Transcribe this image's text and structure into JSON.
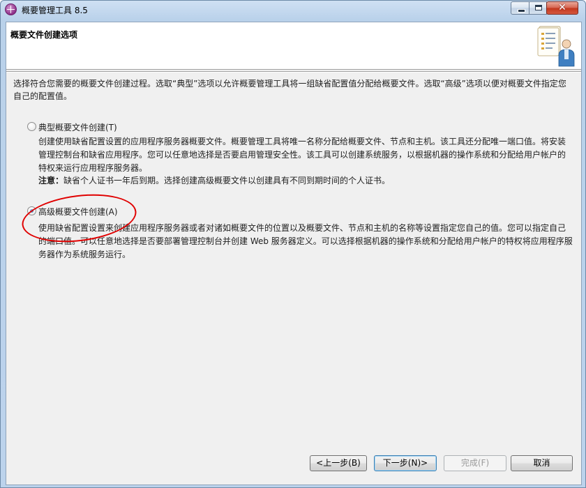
{
  "window": {
    "title": "概要管理工具 8.5",
    "min_glyph": "minimize",
    "max_glyph": "maximize",
    "close_glyph": "✕"
  },
  "banner": {
    "title": "概要文件创建选项",
    "graphic_icon": "document-with-user-icon"
  },
  "intro": "选择符合您需要的概要文件创建过程。选取“典型”选项以允许概要管理工具将一组缺省配置值分配给概要文件。选取“高级”选项以便对概要文件指定您自己的配置值。",
  "options": [
    {
      "label": "典型概要文件创建(T)",
      "selected": false,
      "description": "创建使用缺省配置设置的应用程序服务器概要文件。概要管理工具将唯一名称分配给概要文件、节点和主机。该工具还分配唯一端口值。将安装管理控制台和缺省应用程序。您可以任意地选择是否要启用管理安全性。该工具可以创建系统服务，以根据机器的操作系统和分配给用户帐户的特权来运行应用程序服务器。",
      "note_label": "注意：",
      "note_text": "缺省个人证书一年后到期。选择创建高级概要文件以创建具有不同到期时间的个人证书。"
    },
    {
      "label": "高级概要文件创建(A)",
      "selected": true,
      "description": "使用缺省配置设置来创建应用程序服务器或者对诸如概要文件的位置以及概要文件、节点和主机的名称等设置指定您自己的值。您可以指定自己的端口值。可以任意地选择是否要部署管理控制台并创建 Web 服务器定义。可以选择根据机器的操作系统和分配给用户帐户的特权将应用程序服务器作为系统服务运行。"
    }
  ],
  "annotation": {
    "color": "#e00000",
    "shape": "red-ellipse"
  },
  "buttons": {
    "back": "<上一步(B)",
    "next": "下一步(N)>",
    "finish": "完成(F)",
    "cancel": "取消"
  },
  "states": {
    "finish_enabled": false,
    "next_default": true
  }
}
